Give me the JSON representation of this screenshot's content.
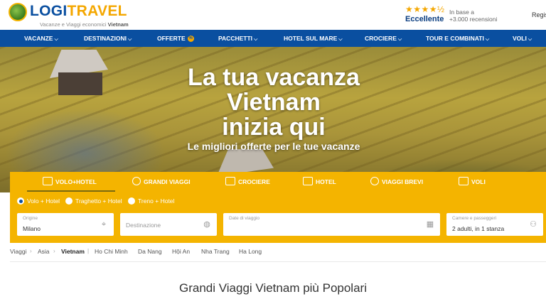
{
  "brand": {
    "name_part1": "LOGI",
    "name_part2": "TRAVEL",
    "tagline": "Vacanze e Viaggi economici",
    "tagline_bold": "Vietnam"
  },
  "rating": {
    "stars": "★★★★½",
    "label": "Eccellente",
    "based_on": "In base a",
    "reviews": "+3.000 recensioni"
  },
  "header": {
    "register": "Regis"
  },
  "nav": {
    "items": [
      {
        "label": "VACANZE",
        "chevron": "⌵"
      },
      {
        "label": "DESTINAZIONI",
        "chevron": "⌵"
      },
      {
        "label": "OFFERTE",
        "chevron": ""
      },
      {
        "label": "PACCHETTI",
        "chevron": "⌵"
      },
      {
        "label": "HOTEL SUL MARE",
        "chevron": "⌵"
      },
      {
        "label": "CROCIERE",
        "chevron": "⌵"
      },
      {
        "label": "TOUR E COMBINATI",
        "chevron": "⌵"
      },
      {
        "label": "VOLI",
        "chevron": "⌵"
      }
    ],
    "offer_badge": "%"
  },
  "hero": {
    "line1": "La tua vacanza",
    "line2": "Vietnam",
    "line3": "inizia qui",
    "subtitle": "Le migliori offerte per le tue vacanze"
  },
  "search": {
    "tabs": [
      {
        "label": "VOLO+HOTEL",
        "icon": "suitcase-icon"
      },
      {
        "label": "GRANDI VIAGGI",
        "icon": "globe-icon"
      },
      {
        "label": "CROCIERE",
        "icon": "ship-icon"
      },
      {
        "label": "HOTEL",
        "icon": "house-icon"
      },
      {
        "label": "VIAGGI BREVI",
        "icon": "balloon-icon"
      },
      {
        "label": "VOLI",
        "icon": "plane-icon"
      }
    ],
    "active_tab": "VOLO+HOTEL",
    "options": [
      {
        "label": "Volo + Hotel",
        "selected": true
      },
      {
        "label": "Traghetto + Hotel",
        "selected": false
      },
      {
        "label": "Treno + Hotel",
        "selected": false
      }
    ],
    "origin_label": "Origine",
    "origin_value": "Milano",
    "destination_placeholder": "Destinazione",
    "date_label": "Date di viaggio",
    "guests_label": "Camere e passeggeri",
    "guests_value": "2 adulti, in 1 stanza"
  },
  "breadcrumb": {
    "items": [
      "Viaggi",
      "Asia",
      "Vietnam"
    ],
    "separator": "›",
    "divider": "|",
    "links": [
      "Ho Chi Minh",
      "Da Nang",
      "Hội An",
      "Nha Trang",
      "Ha Long"
    ]
  },
  "section": {
    "title": "Grandi Viaggi Vietnam più Popolari"
  },
  "colors": {
    "brand_blue": "#0a4fa0",
    "brand_yellow": "#f4b400"
  }
}
